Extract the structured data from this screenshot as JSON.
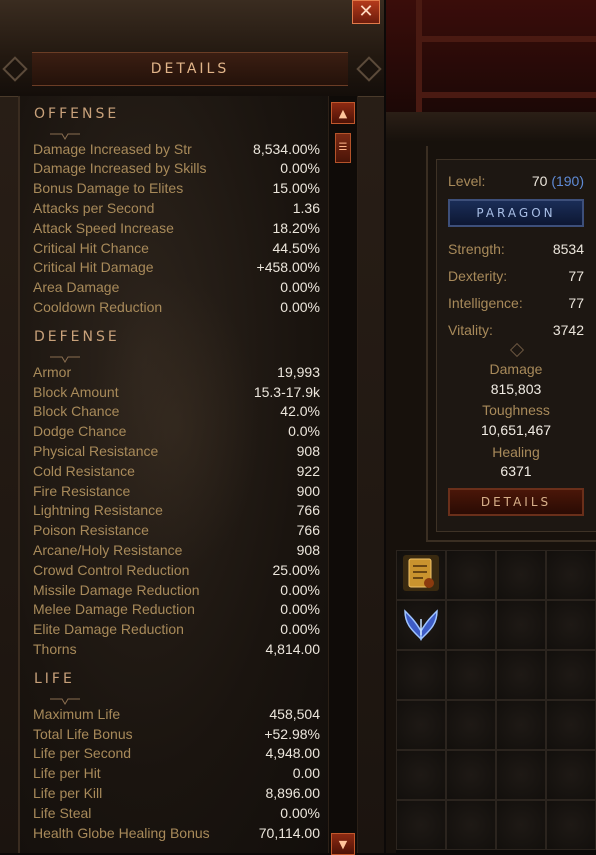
{
  "panel": {
    "title": "DETAILS",
    "close_label": "✕",
    "scroll_up": "▲",
    "scroll_down": "▼",
    "scroll_thumb": "☰"
  },
  "sections": [
    {
      "title": "OFFENSE",
      "rows": [
        {
          "label": "Damage Increased by Str",
          "value": "8,534.00%"
        },
        {
          "label": "Damage Increased by Skills",
          "value": "0.00%"
        },
        {
          "label": "Bonus Damage to Elites",
          "value": "15.00%"
        },
        {
          "label": "Attacks per Second",
          "value": "1.36"
        },
        {
          "label": "Attack Speed Increase",
          "value": "18.20%"
        },
        {
          "label": "Critical Hit Chance",
          "value": "44.50%"
        },
        {
          "label": "Critical Hit Damage",
          "value": "+458.00%"
        },
        {
          "label": "Area Damage",
          "value": "0.00%"
        },
        {
          "label": "Cooldown Reduction",
          "value": "0.00%"
        }
      ]
    },
    {
      "title": "DEFENSE",
      "rows": [
        {
          "label": "Armor",
          "value": "19,993"
        },
        {
          "label": "Block Amount",
          "value": "15.3-17.9k"
        },
        {
          "label": "Block Chance",
          "value": "42.0%"
        },
        {
          "label": "Dodge Chance",
          "value": "0.0%"
        },
        {
          "label": "Physical Resistance",
          "value": "908"
        },
        {
          "label": "Cold Resistance",
          "value": "922"
        },
        {
          "label": "Fire Resistance",
          "value": "900"
        },
        {
          "label": "Lightning Resistance",
          "value": "766"
        },
        {
          "label": "Poison Resistance",
          "value": "766"
        },
        {
          "label": "Arcane/Holy Resistance",
          "value": "908"
        },
        {
          "label": "Crowd Control Reduction",
          "value": "25.00%"
        },
        {
          "label": "Missile Damage Reduction",
          "value": "0.00%"
        },
        {
          "label": "Melee Damage Reduction",
          "value": "0.00%"
        },
        {
          "label": "Elite Damage Reduction",
          "value": "0.00%"
        },
        {
          "label": "Thorns",
          "value": "4,814.00"
        }
      ]
    },
    {
      "title": "LIFE",
      "rows": [
        {
          "label": "Maximum Life",
          "value": "458,504"
        },
        {
          "label": "Total Life Bonus",
          "value": "+52.98%"
        },
        {
          "label": "Life per Second",
          "value": "4,948.00"
        },
        {
          "label": "Life per Hit",
          "value": "0.00"
        },
        {
          "label": "Life per Kill",
          "value": "8,896.00"
        },
        {
          "label": "Life Steal",
          "value": "0.00%"
        },
        {
          "label": "Health Globe Healing Bonus",
          "value": "70,114.00"
        }
      ]
    }
  ],
  "character": {
    "level_label": "Level:",
    "level": "70",
    "paragon_level": "(190)",
    "paragon_button": "PARAGON",
    "attributes": [
      {
        "label": "Strength:",
        "value": "8534"
      },
      {
        "label": "Dexterity:",
        "value": "77"
      },
      {
        "label": "Intelligence:",
        "value": "77"
      },
      {
        "label": "Vitality:",
        "value": "3742"
      }
    ],
    "summary": [
      {
        "label": "Damage",
        "value": "815,803"
      },
      {
        "label": "Toughness",
        "value": "10,651,467"
      },
      {
        "label": "Healing",
        "value": "6371"
      }
    ],
    "details_button": "DETAILS"
  },
  "inventory": {
    "slots": [
      {
        "icon": "scroll-icon"
      },
      {
        "icon": ""
      },
      {
        "icon": ""
      },
      {
        "icon": ""
      },
      {
        "icon": "wings-icon"
      }
    ]
  },
  "colors": {
    "label": "#a88a5a",
    "value": "#ece6dc",
    "paragon": "#5f8bd6",
    "accent_red": "#b43a1b"
  }
}
